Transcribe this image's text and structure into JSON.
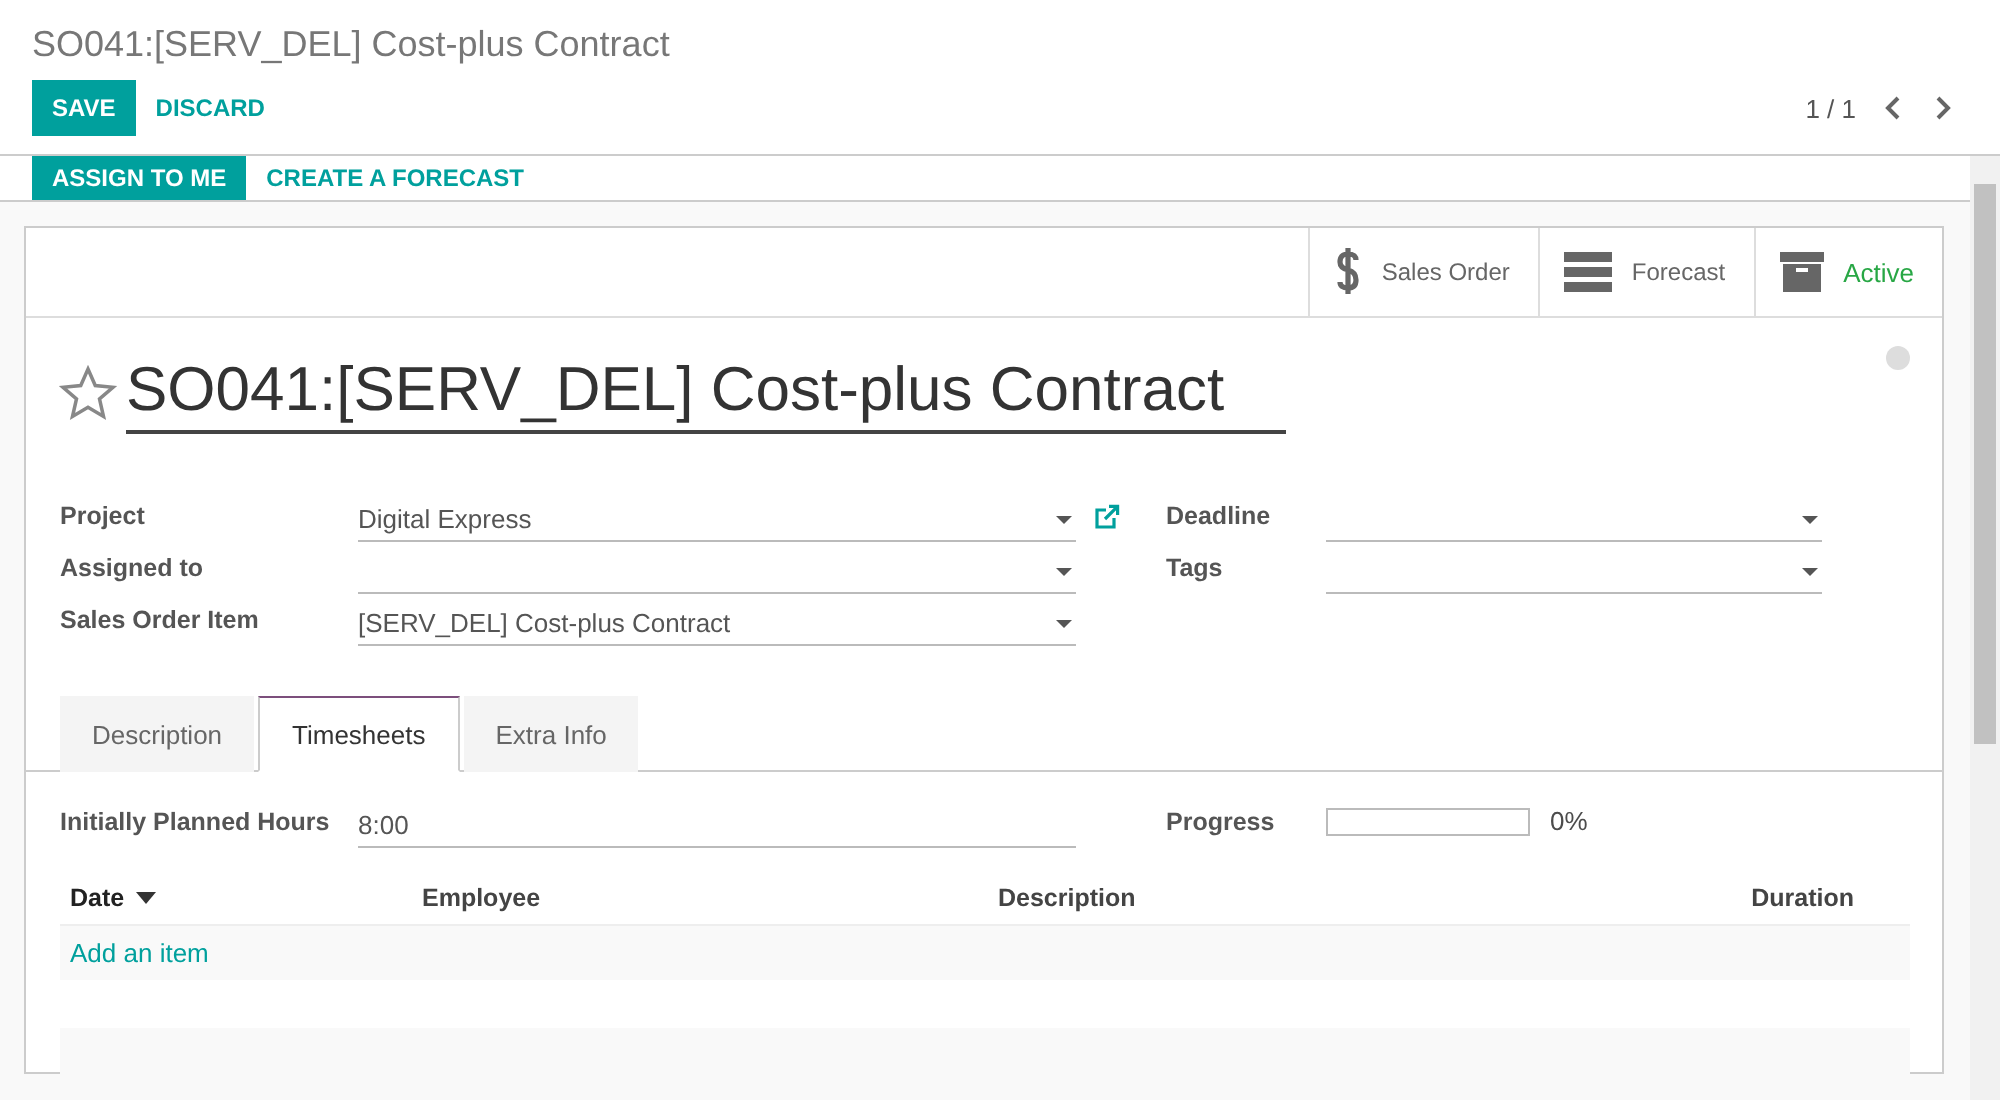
{
  "breadcrumb": "SO041:[SERV_DEL] Cost-plus Contract",
  "buttons": [
    {
      "label": "SAVE",
      "kind": "primary"
    },
    {
      "label": "DISCARD",
      "kind": "link"
    }
  ],
  "pager": "1 / 1",
  "header_buttons": [
    {
      "label": "ASSIGN TO ME",
      "kind": "primary"
    },
    {
      "label": "CREATE A FORECAST",
      "kind": "link"
    }
  ],
  "smart_buttons": [
    {
      "label": "Sales Order",
      "kind": "dollar"
    },
    {
      "label": "Forecast",
      "kind": "forecast"
    },
    {
      "label": "Active",
      "kind": "archive"
    }
  ],
  "title": "SO041:[SERV_DEL] Cost-plus Contract",
  "starred": false,
  "fields_left": [
    {
      "label": "Project",
      "value": "Digital Express",
      "external_link": true
    },
    {
      "label": "Assigned to",
      "external_link": false
    },
    {
      "label": "Sales Order Item",
      "value": "[SERV_DEL] Cost-plus Contract",
      "external_link": false
    }
  ],
  "fields_right": [
    {
      "label": "Deadline"
    },
    {
      "label": "Tags"
    }
  ],
  "tabs": [
    {
      "label": "Description",
      "selected": false
    },
    {
      "label": "Timesheets",
      "selected": true
    },
    {
      "label": "Extra Info",
      "selected": false
    }
  ],
  "planned_hours": {
    "label": "Initially Planned Hours",
    "value": "8:00"
  },
  "progress": {
    "label": "Progress",
    "level": 0,
    "reading": "0%"
  },
  "table": {
    "columns": [
      {
        "label": "Date",
        "sorted": true
      },
      {
        "label": "Employee",
        "sorted": false
      },
      {
        "label": "Description",
        "sorted": false
      },
      {
        "label": "Duration",
        "sorted": false
      }
    ],
    "add_item": "Add an item"
  }
}
